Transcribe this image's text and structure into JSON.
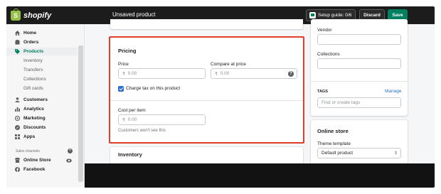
{
  "topbar": {
    "brand": "shopify",
    "page_title": "Unsaved product",
    "setup_guide": "Setup guide: 0/6",
    "discard_label": "Discard",
    "save_label": "Save"
  },
  "sidebar": {
    "items": [
      {
        "label": "Home",
        "icon": "home-icon"
      },
      {
        "label": "Orders",
        "icon": "orders-icon"
      },
      {
        "label": "Products",
        "icon": "tag-icon"
      },
      {
        "label": "Inventory"
      },
      {
        "label": "Transfers"
      },
      {
        "label": "Collections"
      },
      {
        "label": "Gift cards"
      },
      {
        "label": "Customers",
        "icon": "person-icon"
      },
      {
        "label": "Analytics",
        "icon": "bar-chart-icon"
      },
      {
        "label": "Marketing",
        "icon": "target-icon"
      },
      {
        "label": "Discounts",
        "icon": "discount-icon"
      },
      {
        "label": "Apps",
        "icon": "apps-icon"
      }
    ],
    "sales_channels_label": "Sales channels",
    "channels": [
      {
        "label": "Online Store",
        "icon": "store-icon"
      },
      {
        "label": "Facebook",
        "icon": "facebook-icon"
      }
    ]
  },
  "pricing": {
    "title": "Pricing",
    "price_label": "Price",
    "price_placeholder": "0.00",
    "compare_label": "Compare at price",
    "compare_placeholder": "0.00",
    "currency_symbol": "₹",
    "charge_tax_label": "Charge tax on this product",
    "charge_tax_checked": true,
    "cost_label": "Cost per item",
    "cost_placeholder": "0.00",
    "cost_help": "Customers won't see this"
  },
  "inventory": {
    "title": "Inventory"
  },
  "organization": {
    "vendor_label": "Vendor",
    "collections_label": "Collections",
    "tags_label": "TAGS",
    "tags_manage": "Manage",
    "tags_placeholder": "Find or create tags"
  },
  "online_store": {
    "title": "Online store",
    "theme_template_label": "Theme template",
    "theme_template_value": "Default product"
  },
  "colors": {
    "accent": "#008060",
    "highlight": "#e0402b",
    "link": "#2c6ecb"
  }
}
